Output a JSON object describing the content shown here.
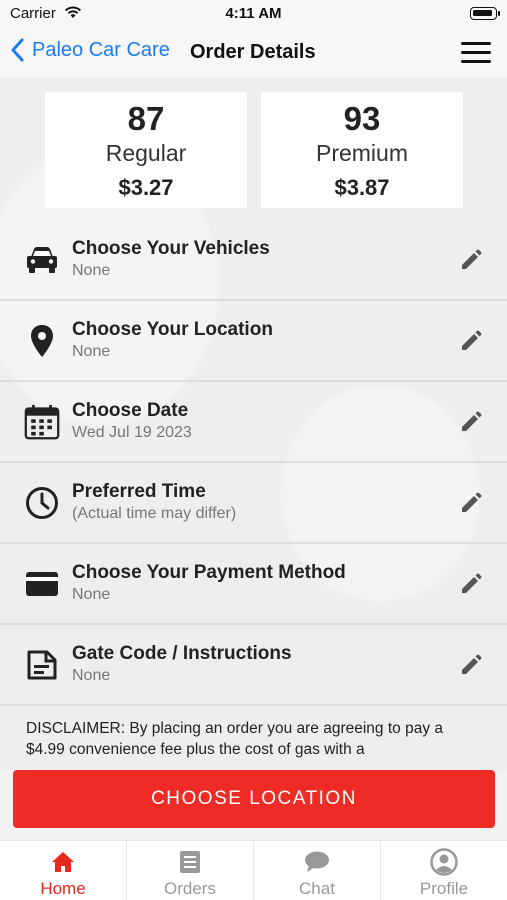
{
  "status": {
    "carrier": "Carrier",
    "time": "4:11 AM"
  },
  "nav": {
    "back_label": "Paleo Car Care",
    "title": "Order Details"
  },
  "fuels": [
    {
      "octane": "87",
      "name": "Regular",
      "price": "$3.27"
    },
    {
      "octane": "93",
      "name": "Premium",
      "price": "$3.87"
    }
  ],
  "options": [
    {
      "title": "Choose Your Vehicles",
      "sub": "None",
      "icon": "car-icon"
    },
    {
      "title": "Choose Your Location",
      "sub": "None",
      "icon": "location-pin-icon"
    },
    {
      "title": "Choose Date",
      "sub": "Wed Jul 19 2023",
      "icon": "calendar-icon"
    },
    {
      "title": "Preferred Time",
      "sub": "(Actual time may differ)",
      "icon": "clock-icon"
    },
    {
      "title": "Choose Your Payment Method",
      "sub": "None",
      "icon": "credit-card-icon"
    },
    {
      "title": "Gate Code / Instructions",
      "sub": "None",
      "icon": "document-icon"
    }
  ],
  "disclaimer": "DISCLAIMER: By placing an order you are agreeing to pay a $4.99 convenience fee plus the cost of gas with a",
  "cta_label": "CHOOSE LOCATION",
  "tabs": [
    {
      "label": "Home",
      "icon": "home-icon",
      "active": true
    },
    {
      "label": "Orders",
      "icon": "orders-icon",
      "active": false
    },
    {
      "label": "Chat",
      "icon": "chat-icon",
      "active": false
    },
    {
      "label": "Profile",
      "icon": "profile-icon",
      "active": false
    }
  ],
  "colors": {
    "accent": "#ee2b24",
    "link": "#1a7cf5",
    "active_tab": "#e8281f"
  }
}
